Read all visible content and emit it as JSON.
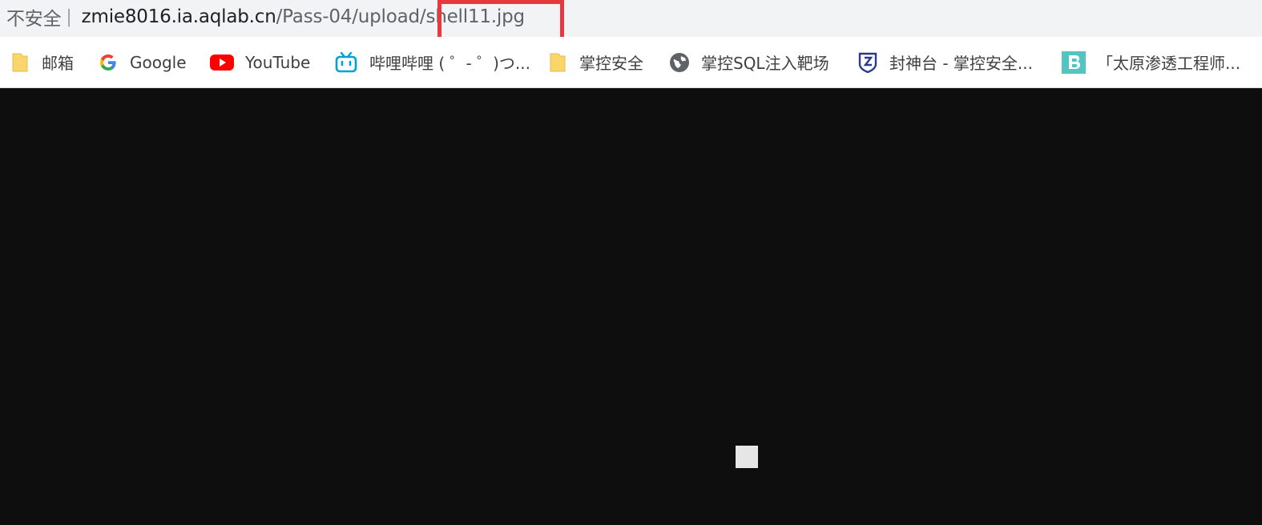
{
  "address_bar": {
    "security_label": "不安全",
    "separator": "|",
    "host": "zmie8016.ia.aqlab.cn",
    "path": "/Pass-04/upload/shell11.jpg"
  },
  "bookmarks": [
    {
      "label": "邮箱",
      "icon": "folder-icon"
    },
    {
      "label": "Google",
      "icon": "google-icon"
    },
    {
      "label": "YouTube",
      "icon": "youtube-icon"
    },
    {
      "label": "哔哩哔哩 ( ゜- ゜)つ...",
      "icon": "bilibili-icon"
    },
    {
      "label": "掌控安全",
      "icon": "folder-icon"
    },
    {
      "label": "掌控SQL注入靶场",
      "icon": "globe-icon"
    },
    {
      "label": "封神台 - 掌控安全...",
      "icon": "fengshentai-icon"
    },
    {
      "label": "「太原渗透工程师...",
      "icon": "b-letter-icon"
    }
  ],
  "colors": {
    "highlight": "#e8383d",
    "page_background": "#0e0e0e"
  }
}
